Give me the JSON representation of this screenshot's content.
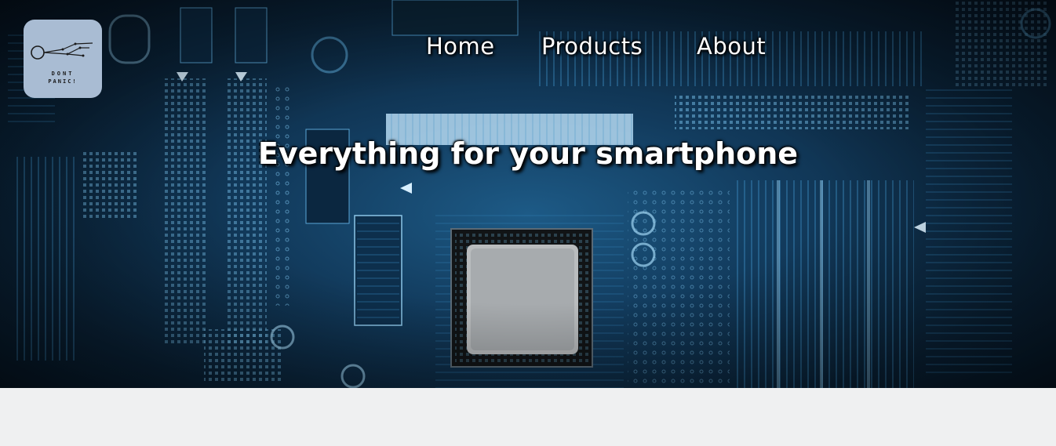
{
  "logo": {
    "line1": "DONT",
    "line2": "PANIC!"
  },
  "nav": {
    "items": [
      {
        "label": "Home"
      },
      {
        "label": "Products"
      },
      {
        "label": "About"
      }
    ]
  },
  "hero": {
    "headline": "Everything for your smartphone"
  },
  "colors": {
    "page_background": "#eff0f1",
    "logo_background": "#a9bcd3",
    "text": "#ffffff"
  }
}
